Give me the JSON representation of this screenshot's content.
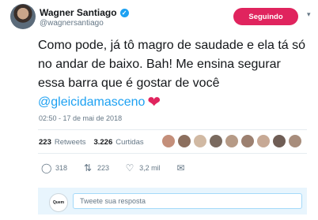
{
  "author": {
    "name": "Wagner Santiago",
    "handle": "@wagnersantiago",
    "verified_icon": "verified-badge-icon"
  },
  "follow_button": {
    "label": "Seguindo",
    "color": "#e0245e"
  },
  "tweet": {
    "text": "Como pode, já tô magro de saudade e ela tá só no andar de baixo. Bah! Me ensina segurar essa barra que é gostar de você",
    "mention": "@gleicidamasceno",
    "emoji": "❤"
  },
  "timestamp": "02:50 - 17 de mai de 2018",
  "stats": {
    "retweets_count": "223",
    "retweets_label": "Retweets",
    "likes_count": "3.226",
    "likes_label": "Curtidas"
  },
  "actions": {
    "replies": "318",
    "retweets": "223",
    "likes": "3,2 mil"
  },
  "reply": {
    "avatar_label": "Quem",
    "placeholder": "Tweete sua resposta"
  },
  "colors": {
    "link": "#1da1f2",
    "secondary_text": "#657786",
    "reply_bg": "#e8f5fd"
  }
}
